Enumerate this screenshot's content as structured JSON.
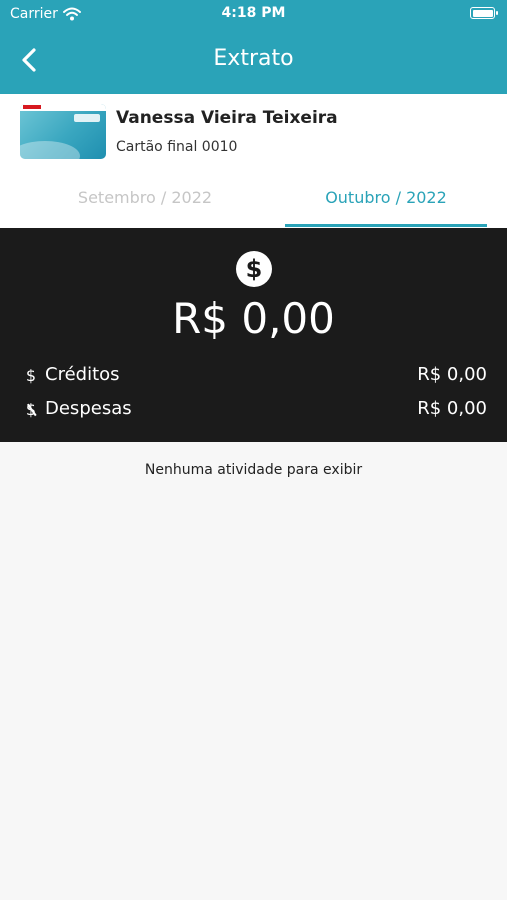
{
  "status_bar": {
    "carrier": "Carrier",
    "time": "4:18 PM"
  },
  "header": {
    "title": "Extrato"
  },
  "card": {
    "holder_name": "Vanessa Vieira Teixeira",
    "card_final": "Cartão final 0010"
  },
  "tabs": [
    {
      "label": "Setembro / 2022",
      "active": false
    },
    {
      "label": "Outubro / 2022",
      "active": true
    }
  ],
  "summary": {
    "total": "R$  0,00",
    "credits_label": "Créditos",
    "credits_value": "R$  0,00",
    "expenses_label": "Despesas",
    "expenses_value": "R$  0,00"
  },
  "empty_message": "Nenhuma atividade para exibir",
  "colors": {
    "accent": "#2aa3b8",
    "summary_bg": "#1b1b1b",
    "inactive_tab": "#c6c6c6"
  },
  "icons": [
    "wifi-icon",
    "battery-icon",
    "back-chevron-icon",
    "dollar-circle-icon",
    "dollar-icon",
    "no-dollar-icon"
  ]
}
